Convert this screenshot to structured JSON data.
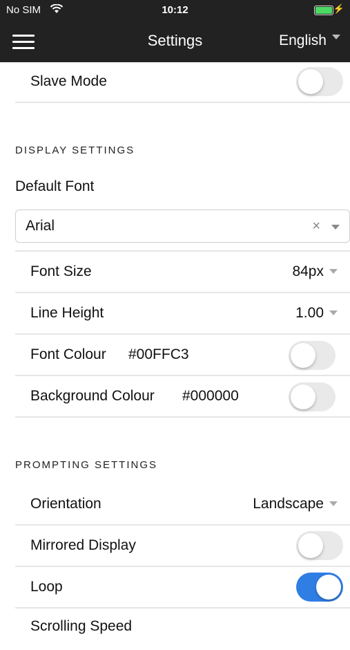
{
  "status_bar": {
    "carrier": "No SIM",
    "time": "10:12"
  },
  "nav": {
    "title": "Settings",
    "language": "English"
  },
  "rows": {
    "slave_mode": {
      "label": "Slave Mode",
      "on": false
    },
    "font_size": {
      "label": "Font Size",
      "value": "84px"
    },
    "line_height": {
      "label": "Line Height",
      "value": "1.00"
    },
    "font_colour": {
      "label": "Font Colour",
      "hex": "#00FFC3",
      "on": false
    },
    "background_colour": {
      "label": "Background Colour",
      "hex": "#000000",
      "on": false
    },
    "orientation": {
      "label": "Orientation",
      "value": "Landscape"
    },
    "mirrored_display": {
      "label": "Mirrored Display",
      "on": false
    },
    "loop": {
      "label": "Loop",
      "on": true
    },
    "scrolling_speed": {
      "label": "Scrolling Speed"
    }
  },
  "display_settings": {
    "header": "DISPLAY SETTINGS",
    "default_font_label": "Default Font",
    "default_font_value": "Arial"
  },
  "prompting_settings": {
    "header": "PROMPTING SETTINGS"
  },
  "colors": {
    "bar": "#222222",
    "toggle_on": "#2f7ee3",
    "battery": "#4cd964"
  }
}
